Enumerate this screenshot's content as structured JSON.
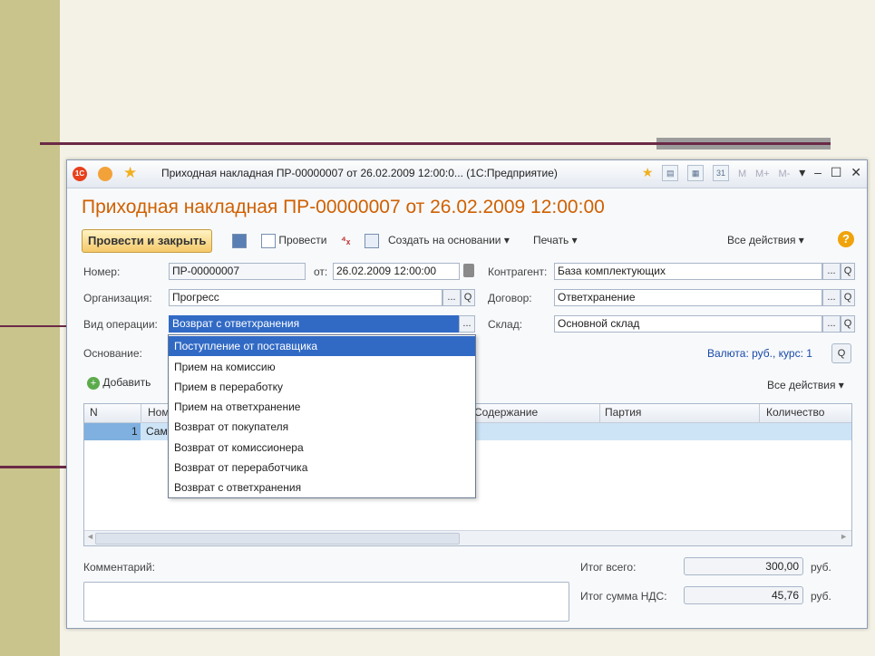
{
  "window": {
    "title": "Приходная накладная ПР-00000007 от 26.02.2009 12:00:0...  (1С:Предприятие)",
    "controls": [
      "M",
      "M+",
      "M-",
      "▾",
      "–",
      "☐",
      "✕"
    ]
  },
  "document": {
    "heading": "Приходная накладная ПР-00000007 от 26.02.2009 12:00:00"
  },
  "toolbar": {
    "post_close": "Провести и закрыть",
    "post": "Провести",
    "create_based": "Создать на основании ▾",
    "print": "Печать ▾",
    "all_actions": "Все действия ▾",
    "help": "?"
  },
  "form": {
    "number_label": "Номер:",
    "number_value": "ПР-00000007",
    "date_label": "от:",
    "date_value": "26.02.2009 12:00:00",
    "counterparty_label": "Контрагент:",
    "counterparty_value": "База комплектующих",
    "org_label": "Организация:",
    "org_value": "Прогресс",
    "contract_label": "Договор:",
    "contract_value": "Ответхранение",
    "op_label": "Вид операции:",
    "op_value": "Возврат с ответхранения",
    "warehouse_label": "Склад:",
    "warehouse_value": "Основной склад",
    "basis_label": "Основание:",
    "currency_text": "Валюта: руб., курс: 1",
    "ellipsis": "...",
    "search_glyph": "Q"
  },
  "table_toolbar": {
    "add": "Добавить",
    "all_actions": "Все действия ▾"
  },
  "table": {
    "headers": [
      "N",
      "Ном",
      "Содержание",
      "Партия",
      "Количество"
    ],
    "rows": [
      {
        "n": "1",
        "nom": "Сам"
      }
    ]
  },
  "dropdown": {
    "items": [
      "Поступление от поставщика",
      "Прием на комиссию",
      "Прием в переработку",
      "Прием на ответхранение",
      "Возврат от покупателя",
      "Возврат от комиссионера",
      "Возврат от переработчика",
      "Возврат с ответхранения"
    ],
    "highlighted_index": 0
  },
  "footer": {
    "comment_label": "Комментарий:",
    "total_label": "Итог всего:",
    "total_value": "300,00",
    "vat_label": "Итог сумма НДС:",
    "vat_value": "45,76",
    "currency": "руб."
  },
  "colors": {
    "accent_title": "#d06000",
    "selection": "#316ac5",
    "row_highlight": "#cde4f7",
    "slide_band": "#c9c48c",
    "slide_line": "#6b2a47"
  }
}
